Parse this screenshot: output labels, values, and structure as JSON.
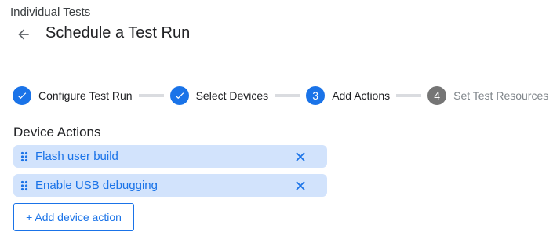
{
  "header": {
    "breadcrumb": "Individual Tests",
    "title": "Schedule a Test Run",
    "back_icon": "arrow-back-icon"
  },
  "stepper": {
    "steps": [
      {
        "number": "1",
        "label": "Configure Test Run",
        "state": "completed"
      },
      {
        "number": "2",
        "label": "Select Devices",
        "state": "completed"
      },
      {
        "number": "3",
        "label": "Add Actions",
        "state": "active"
      },
      {
        "number": "4",
        "label": "Set Test Resources",
        "state": "pending"
      }
    ]
  },
  "device_actions": {
    "title": "Device Actions",
    "items": [
      {
        "label": "Flash user build"
      },
      {
        "label": "Enable USB debugging"
      }
    ],
    "add_button_label": "+ Add device action"
  },
  "colors": {
    "accent": "#1a73e8",
    "chip_background": "#d2e3fc",
    "pending_step": "#757575",
    "divider": "#dadce0"
  }
}
